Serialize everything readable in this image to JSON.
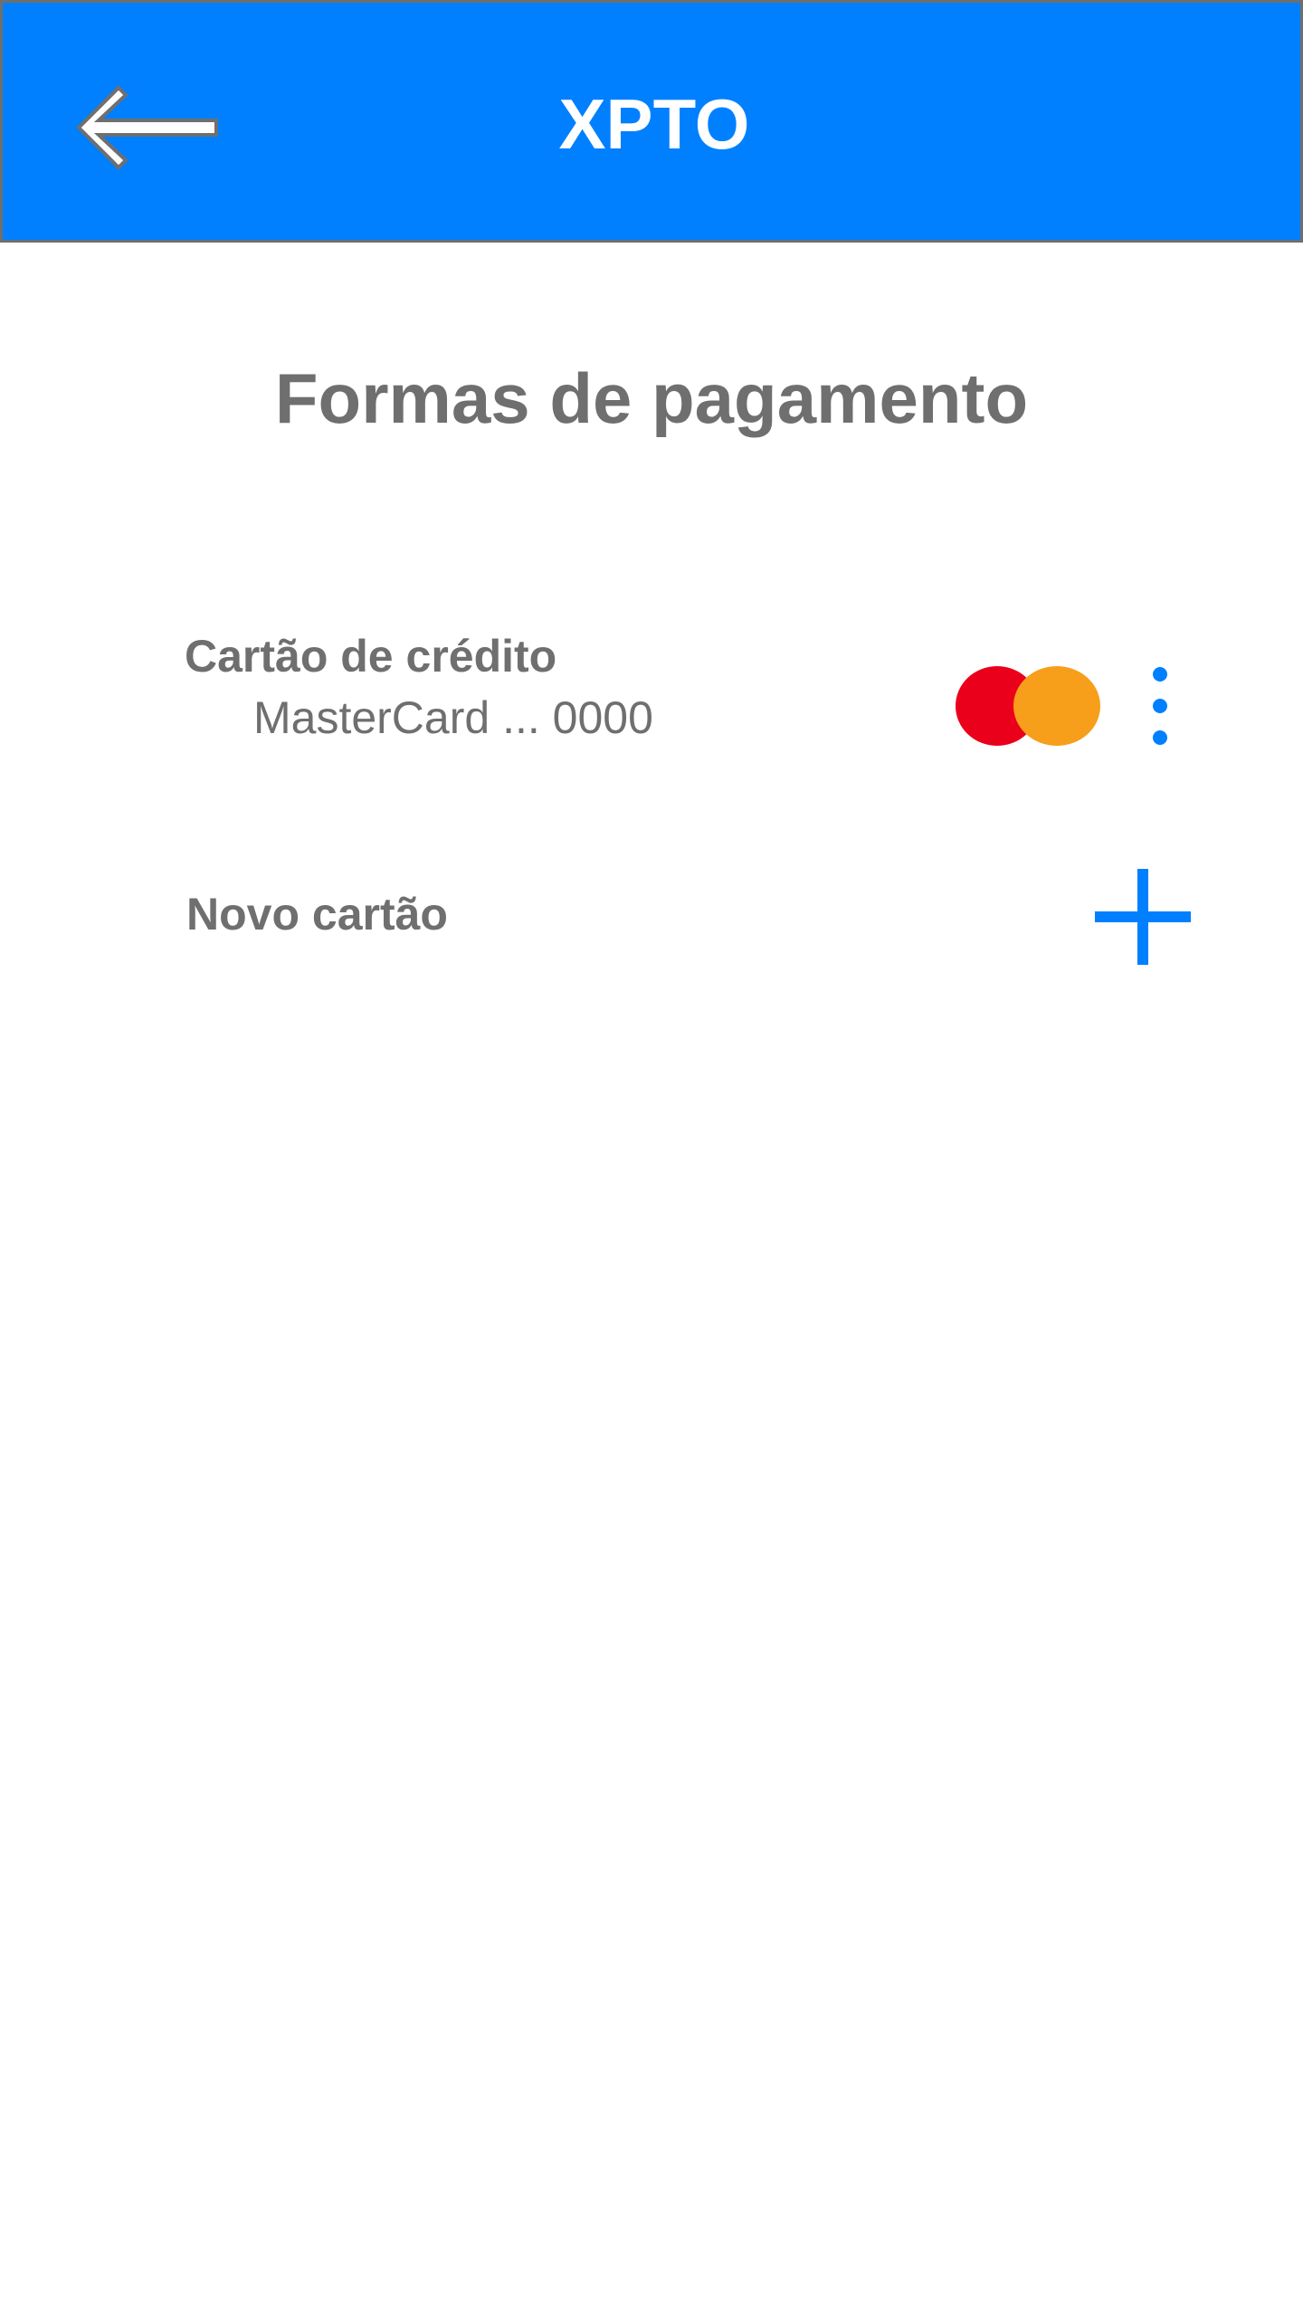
{
  "app_bar": {
    "title": "XPTO",
    "background_color": "#0080FF",
    "back_icon": "arrow-left-icon"
  },
  "page": {
    "title": "Formas de pagamento"
  },
  "payment_methods": [
    {
      "type_label": "Cartão de crédito",
      "card_label": "MasterCard ... 0000",
      "brand_icon": "mastercard-icon",
      "menu_icon": "more-vertical-icon"
    }
  ],
  "new_card": {
    "label": "Novo cartão",
    "icon": "plus-icon"
  },
  "colors": {
    "accent": "#0080FF",
    "text": "#6f6f6f",
    "mastercard_red": "#EB001B",
    "mastercard_orange": "#F79E1B"
  }
}
